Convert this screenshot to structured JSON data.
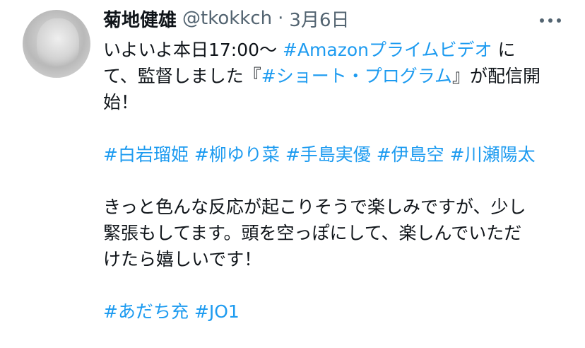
{
  "author": {
    "display_name": "菊地健雄",
    "handle": "@tkokkch",
    "separator": "·",
    "date": "3月6日"
  },
  "menu": {
    "icon": "more-horizontal-icon"
  },
  "tweet": {
    "line1": {
      "text1": "いよいよ本日17:00〜 ",
      "hashtag": "#Amazonプライムビデオ",
      "text2": " に"
    },
    "line2": {
      "text1": "て、監督しました『",
      "hashtag": "#ショート・プログラム",
      "text2": "』が配信開"
    },
    "line3": {
      "text": "始！"
    },
    "hashtags_cast": [
      "#白岩瑠姫",
      "#柳ゆり菜",
      "#手島実優",
      "#伊島空",
      "#川瀬陽太"
    ],
    "line5": {
      "text": "きっと色んな反応が起こりそうで楽しみですが、少し"
    },
    "line6": {
      "text": "緊張もしてます。頭を空っぽにして、楽しんでいただ"
    },
    "line7": {
      "text": "けたら嬉しいです！"
    },
    "hashtags_end": [
      "#あだち充",
      "#JO1"
    ]
  },
  "colors": {
    "link": "#1d9bf0",
    "text": "#0f1419",
    "secondary": "#536471"
  }
}
